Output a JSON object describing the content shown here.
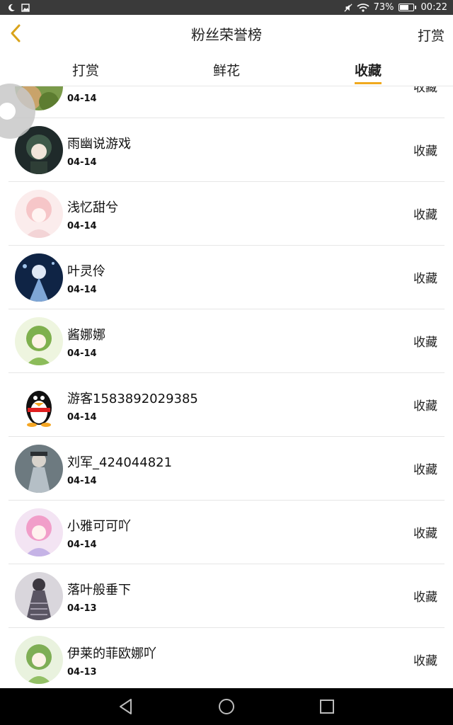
{
  "status_bar": {
    "battery": "73%",
    "battery_level": 0.73,
    "time": "00:22"
  },
  "header": {
    "title": "粉丝荣誉榜",
    "right_action": "打赏"
  },
  "tabs": [
    {
      "label": "打赏"
    },
    {
      "label": "鲜花"
    },
    {
      "label": "收藏"
    }
  ],
  "active_tab": "收藏",
  "rows": [
    {
      "name": "",
      "date": "04-14",
      "action": "收藏"
    },
    {
      "name": "雨幽说游戏",
      "date": "04-14",
      "action": "收藏"
    },
    {
      "name": "浅忆甜兮",
      "date": "04-14",
      "action": "收藏"
    },
    {
      "name": "叶灵伶",
      "date": "04-14",
      "action": "收藏"
    },
    {
      "name": "酱娜娜",
      "date": "04-14",
      "action": "收藏"
    },
    {
      "name": "游客1583892029385",
      "date": "04-14",
      "action": "收藏"
    },
    {
      "name": "刘军_424044821",
      "date": "04-14",
      "action": "收藏"
    },
    {
      "name": "小雅可可吖",
      "date": "04-14",
      "action": "收藏"
    },
    {
      "name": "落叶般垂下",
      "date": "04-13",
      "action": "收藏"
    },
    {
      "name": "伊莱的菲欧娜吖",
      "date": "04-13",
      "action": "收藏"
    }
  ],
  "colors": {
    "accent": "#f0a91e",
    "status_bar": "#3a3a3a",
    "nav_bar": "#000000"
  },
  "icons": [
    "back-arrow-icon",
    "floating-ball-icon",
    "nav-back-icon",
    "nav-home-icon",
    "nav-recent-icon"
  ]
}
